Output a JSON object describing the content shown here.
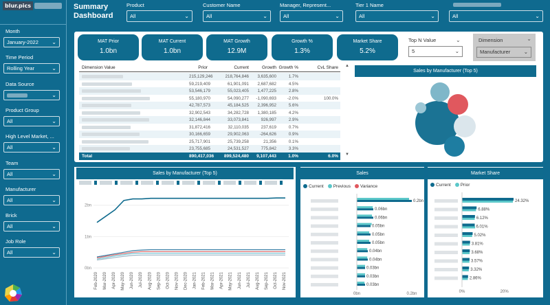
{
  "watermark": "blur.pics",
  "header": {
    "title": "Summary Dashboard"
  },
  "filters": [
    {
      "label": "Product",
      "value": "All"
    },
    {
      "label": "Customer Name",
      "value": "All"
    },
    {
      "label": "Manager, Represent...",
      "value": "All"
    },
    {
      "label": "Tier 1 Name",
      "value": "All"
    },
    {
      "label": "",
      "value": "All"
    }
  ],
  "sidebar": [
    {
      "label": "Month",
      "value": "January-2022"
    },
    {
      "label": "Time Period",
      "value": "Rolling Year"
    },
    {
      "label": "Data Source",
      "value": ""
    },
    {
      "label": "Product Group",
      "value": "All"
    },
    {
      "label": "High Level Market, ...",
      "value": "All"
    },
    {
      "label": "Team",
      "value": "All"
    },
    {
      "label": "Manufacturer",
      "value": "All"
    },
    {
      "label": "Brick",
      "value": "All"
    },
    {
      "label": "Job Role",
      "value": "All"
    }
  ],
  "kpis": [
    {
      "title": "MAT Prior",
      "value": "1.0bn"
    },
    {
      "title": "MAT Current",
      "value": "1.0bn"
    },
    {
      "title": "MAT Growth",
      "value": "12.9M"
    },
    {
      "title": "Growth %",
      "value": "1.3%"
    },
    {
      "title": "Market Share",
      "value": "5.2%"
    }
  ],
  "topn": {
    "label": "Top N Value",
    "value": "5"
  },
  "dimension": {
    "label": "Dimension",
    "value": "Manufacturer"
  },
  "table": {
    "headers": [
      "Dimension Value",
      "Prior",
      "Current",
      "Growth",
      "Growth %",
      "CvL Share"
    ],
    "rows": [
      [
        "215,129,246",
        "218,764,846",
        "3,635,600",
        "1.7%",
        ""
      ],
      [
        "59,219,409",
        "61,901,091",
        "2,687,682",
        "4.5%",
        ""
      ],
      [
        "53,546,179",
        "55,023,405",
        "1,477,225",
        "2.8%",
        ""
      ],
      [
        "55,180,970",
        "54,090,277",
        "-1,090,693",
        "-2.0%",
        "100.0%"
      ],
      [
        "42,787,573",
        "45,184,525",
        "2,396,952",
        "5.6%",
        ""
      ],
      [
        "32,902,543",
        "34,282,728",
        "1,380,185",
        "4.2%",
        ""
      ],
      [
        "32,146,844",
        "33,073,841",
        "926,997",
        "2.9%",
        ""
      ],
      [
        "31,872,416",
        "32,110,035",
        "237,619",
        "0.7%",
        ""
      ],
      [
        "30,166,659",
        "29,902,063",
        "-264,626",
        "0.9%",
        ""
      ],
      [
        "25,717,901",
        "25,739,258",
        "21,356",
        "0.1%",
        ""
      ],
      [
        "23,755,685",
        "24,531,527",
        "775,842",
        "3.3%",
        ""
      ]
    ],
    "total": [
      "Total",
      "890,417,036",
      "899,524,480",
      "9,107,443",
      "1.0%",
      "6.0%"
    ]
  },
  "bubble_title": "Sales by Manufacturer (Top 5)",
  "line_chart": {
    "title": "Sales by Manufacturer (Top 5)",
    "yticks": [
      "2bn",
      "1bn",
      "0bn"
    ]
  },
  "chart_data": [
    {
      "type": "line",
      "title": "Sales by Manufacturer (Top 5)",
      "x": [
        "Feb-2020",
        "Mar-2020",
        "Apr-2020",
        "May-2020",
        "Jun-2020",
        "Jul-2020",
        "Aug-2020",
        "Sep-2020",
        "Oct-2020",
        "Nov-2020",
        "Dec-2020",
        "Jan-2021",
        "Feb-2021",
        "Mar-2021",
        "Apr-2021",
        "May-2021",
        "Jun-2021",
        "Jul-2021",
        "Aug-2021",
        "Sep-2021",
        "Oct-2021",
        "Nov-2021"
      ],
      "ylim": [
        0,
        2.3
      ],
      "series": [
        {
          "color": "#0f6b8e",
          "values": [
            1.45,
            1.65,
            1.85,
            2.15,
            2.2,
            2.2,
            2.22,
            2.22,
            2.22,
            2.22,
            2.22,
            2.22,
            2.22,
            2.22,
            2.22,
            2.22,
            2.22,
            2.22,
            2.22,
            2.22,
            2.23,
            2.23
          ]
        },
        {
          "color": "#3a7fa6",
          "values": [
            0.35,
            0.4,
            0.45,
            0.5,
            0.55,
            0.57,
            0.58,
            0.58,
            0.58,
            0.58,
            0.58,
            0.58,
            0.58,
            0.58,
            0.58,
            0.58,
            0.58,
            0.58,
            0.58,
            0.58,
            0.58,
            0.58
          ]
        },
        {
          "color": "#e06d6d",
          "values": [
            0.32,
            0.37,
            0.42,
            0.46,
            0.5,
            0.52,
            0.52,
            0.52,
            0.52,
            0.52,
            0.52,
            0.52,
            0.52,
            0.52,
            0.52,
            0.52,
            0.52,
            0.52,
            0.52,
            0.52,
            0.52,
            0.52
          ]
        },
        {
          "color": "#6fc3d3",
          "values": [
            0.28,
            0.33,
            0.38,
            0.42,
            0.46,
            0.47,
            0.47,
            0.47,
            0.47,
            0.47,
            0.47,
            0.47,
            0.47,
            0.47,
            0.47,
            0.47,
            0.47,
            0.47,
            0.47,
            0.47,
            0.47,
            0.47
          ]
        },
        {
          "color": "#9fb8c8",
          "values": [
            0.25,
            0.29,
            0.33,
            0.37,
            0.4,
            0.41,
            0.41,
            0.41,
            0.41,
            0.41,
            0.41,
            0.41,
            0.41,
            0.41,
            0.41,
            0.41,
            0.41,
            0.41,
            0.41,
            0.41,
            0.41,
            0.41
          ]
        }
      ]
    },
    {
      "type": "bar",
      "title": "Sales",
      "legend": [
        "Current",
        "Previous",
        "Variance"
      ],
      "colors": [
        "#0f6b8e",
        "#5bc7c9",
        "#e0585e"
      ],
      "label_values": [
        "0.2bn",
        "0.06bn",
        "0.06bn",
        "0.05bn",
        "0.05bn",
        "0.05bn",
        "0.04bn",
        "0.04bn",
        "0.03bn",
        "0.03bn",
        "0.03bn"
      ],
      "current": [
        0.2,
        0.06,
        0.06,
        0.05,
        0.05,
        0.05,
        0.04,
        0.04,
        0.03,
        0.03,
        0.03
      ],
      "previous": [
        0.19,
        0.058,
        0.055,
        0.054,
        0.045,
        0.045,
        0.038,
        0.038,
        0.03,
        0.03,
        0.028
      ],
      "xticks": [
        "0bn",
        "0.2bn"
      ]
    },
    {
      "type": "bar",
      "title": "Market Share",
      "legend": [
        "Current",
        "Prior"
      ],
      "colors": [
        "#0f6b8e",
        "#5bc7c9"
      ],
      "labels": [
        "24.32%",
        "6.88%",
        "6.12%",
        "6.01%",
        "5.02%",
        "3.81%",
        "3.68%",
        "3.57%",
        "3.32%",
        "2.86%"
      ],
      "current": [
        24.32,
        6.88,
        6.12,
        6.01,
        5.02,
        3.81,
        3.68,
        3.57,
        3.32,
        2.86
      ],
      "prior": [
        24.0,
        6.6,
        6.0,
        6.2,
        4.8,
        3.7,
        3.6,
        3.5,
        3.2,
        2.75
      ],
      "xticks": [
        "0%",
        "20%"
      ]
    }
  ]
}
